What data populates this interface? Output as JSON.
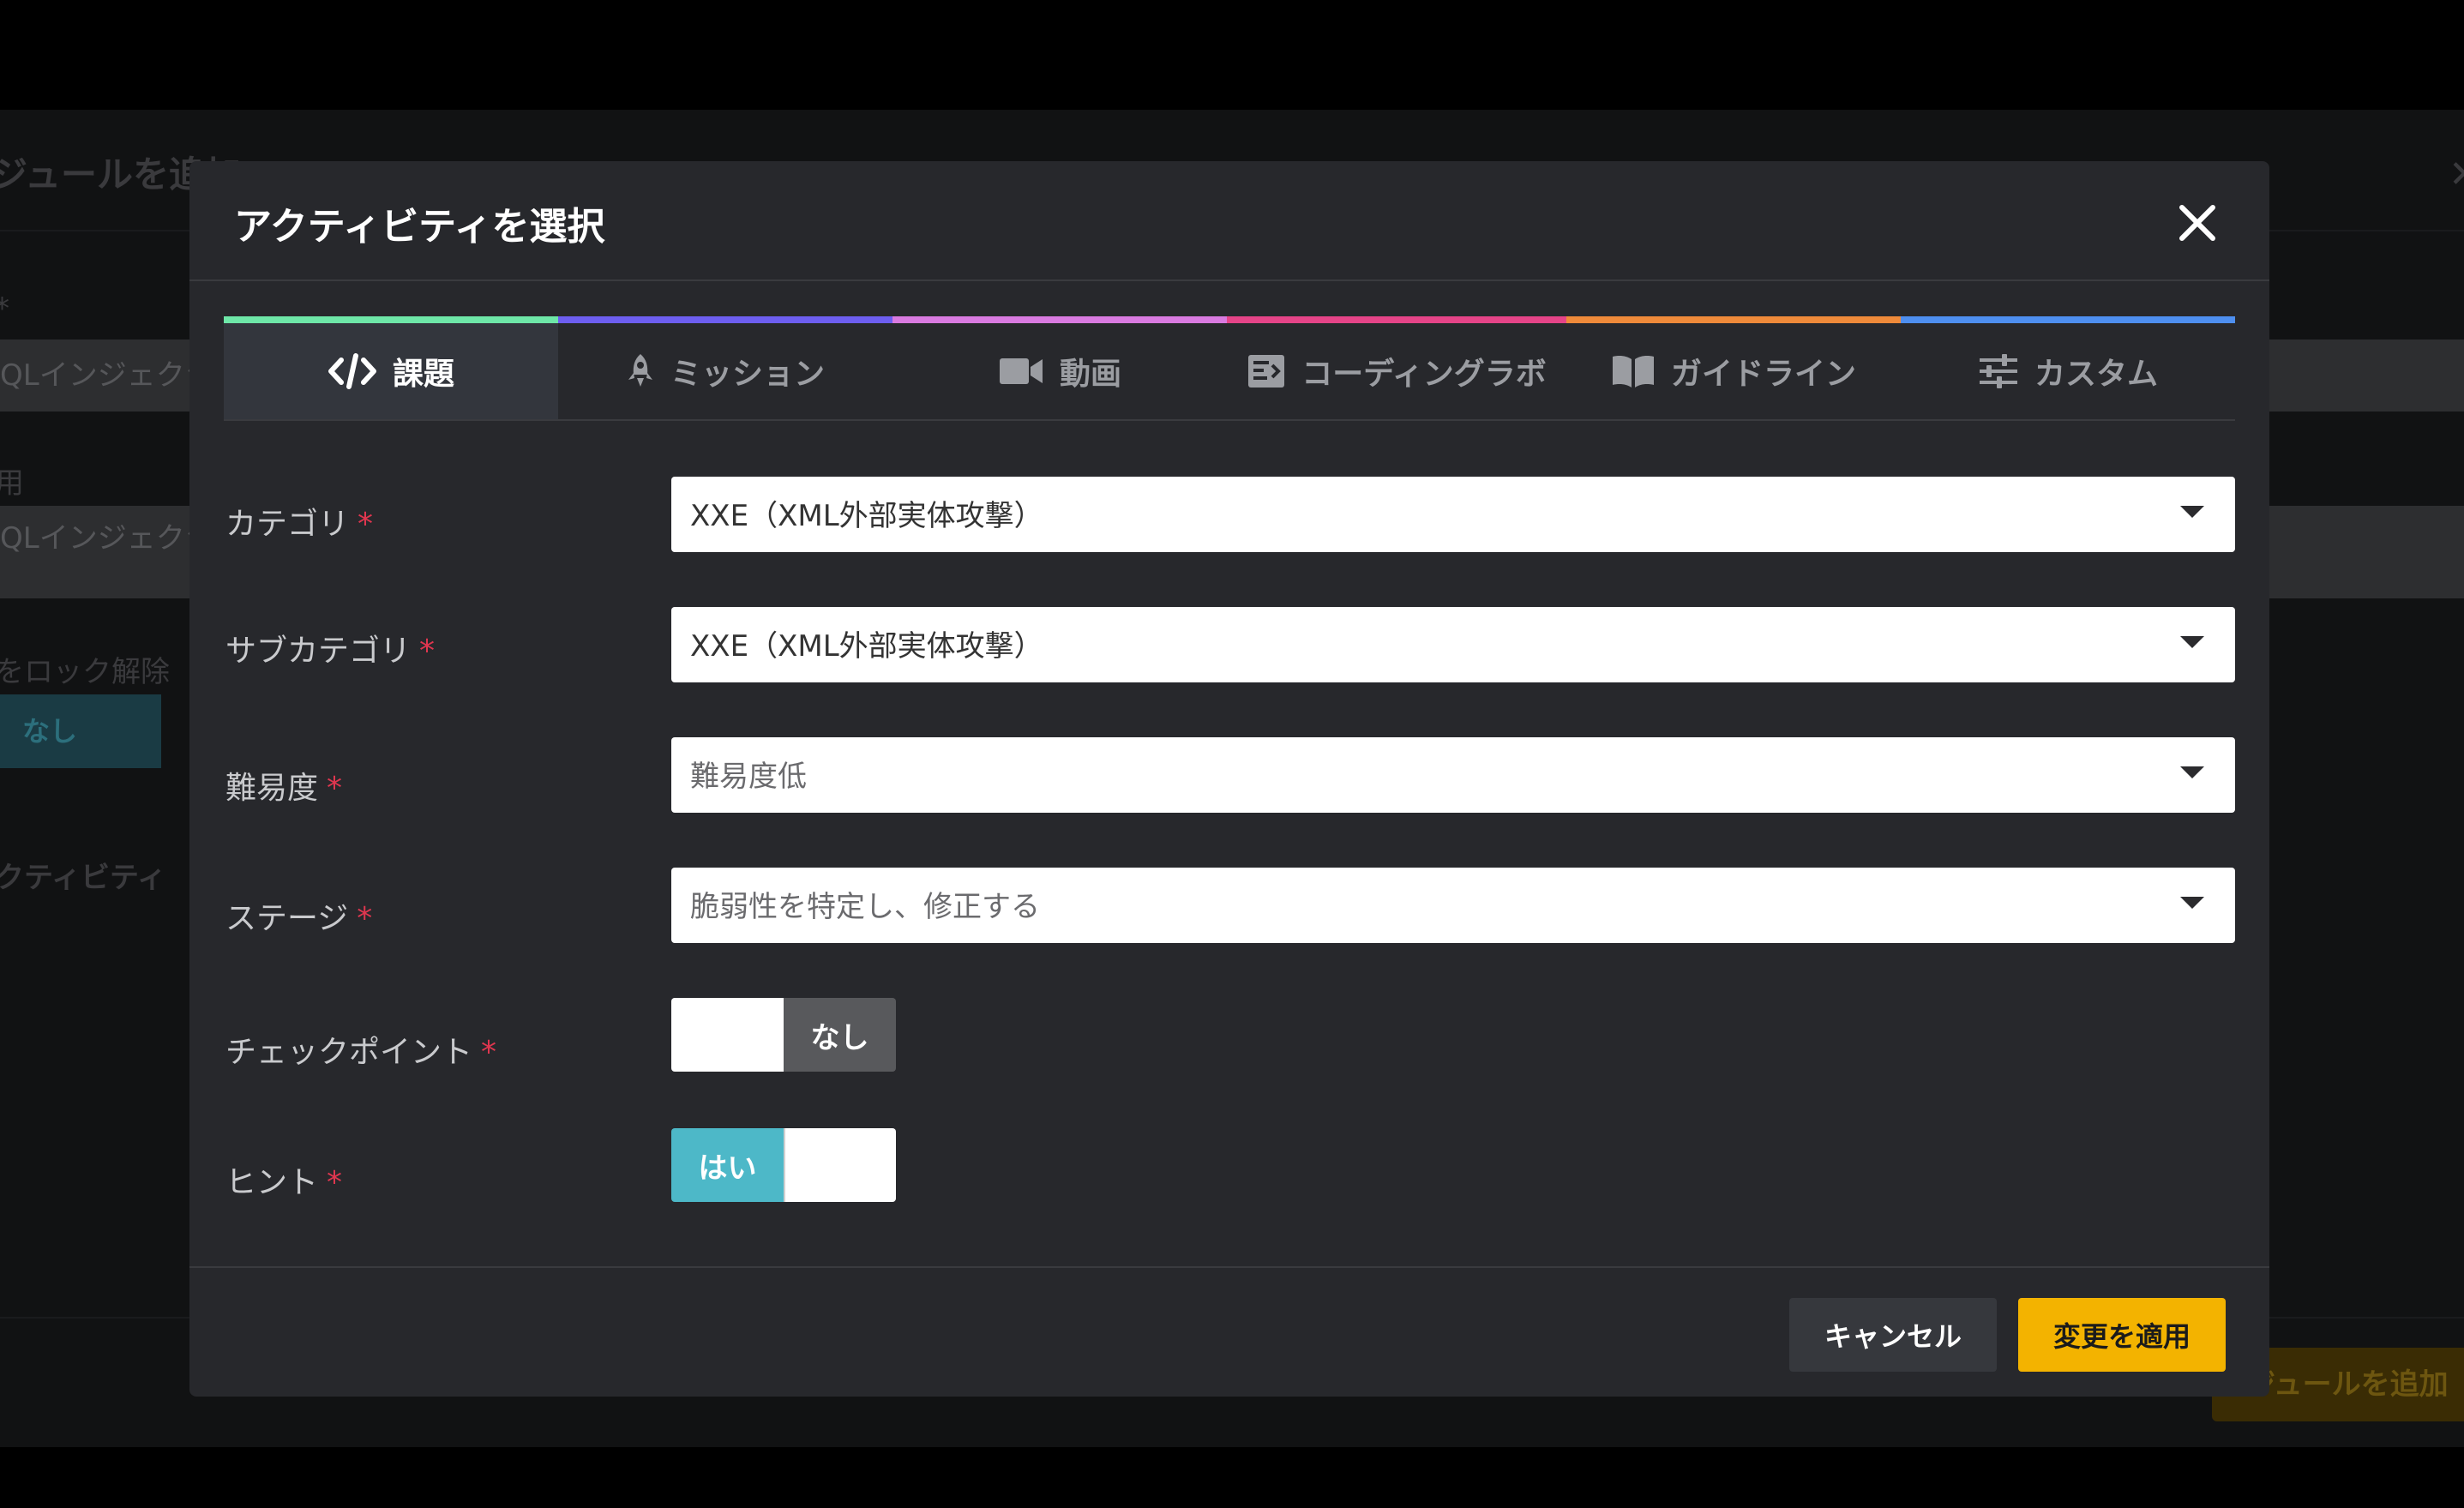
{
  "background": {
    "page_title": "ジュールを追加",
    "fields": [
      {
        "label": "*",
        "value": "QLインジェクシ"
      },
      {
        "label": "用",
        "value": "QLインジェクシ"
      }
    ],
    "unlock_label": "をロック解除",
    "unlock_toggle": "なし",
    "activity_label": "クティビティ",
    "add_button": "ジュールを追加"
  },
  "modal": {
    "title": "アクティビティを選択",
    "close_icon": "close-icon"
  },
  "tabs": [
    {
      "label": "課題",
      "icon": "code-icon",
      "accent": "#6ee7a8",
      "active": true
    },
    {
      "label": "ミッション",
      "icon": "rocket-icon",
      "accent": "#6d5ef0",
      "active": false
    },
    {
      "label": "動画",
      "icon": "video-icon",
      "accent": "#d97ae0",
      "active": false
    },
    {
      "label": "コーディングラボ",
      "icon": "coding-lab-icon",
      "accent": "#e54488",
      "active": false
    },
    {
      "label": "ガイドライン",
      "icon": "book-icon",
      "accent": "#ef8a3a",
      "active": false
    },
    {
      "label": "カスタム",
      "icon": "sliders-icon",
      "accent": "#4e8ff0",
      "active": false
    }
  ],
  "form": {
    "category": {
      "label": "カテゴリ",
      "required": "*",
      "value": "XXE（XML外部実体攻撃）"
    },
    "subcategory": {
      "label": "サブカテゴリ",
      "required": "*",
      "value": "XXE（XML外部実体攻撃）"
    },
    "difficulty": {
      "label": "難易度",
      "required": "*",
      "value": "難易度低"
    },
    "stage": {
      "label": "ステージ",
      "required": "*",
      "value": "脆弱性を特定し、修正する"
    },
    "checkpoint": {
      "label": "チェックポイント",
      "required": "*",
      "selected": "なし",
      "selected_color": "#58595c"
    },
    "hint": {
      "label": "ヒント",
      "required": "*",
      "selected": "はい",
      "selected_color": "#4db8c8"
    }
  },
  "footer": {
    "cancel_label": "キャンセル",
    "apply_label": "変更を適用"
  },
  "colors": {
    "modal_bg": "#27282c",
    "apply": "#f3b300",
    "required": "#e0364f"
  }
}
